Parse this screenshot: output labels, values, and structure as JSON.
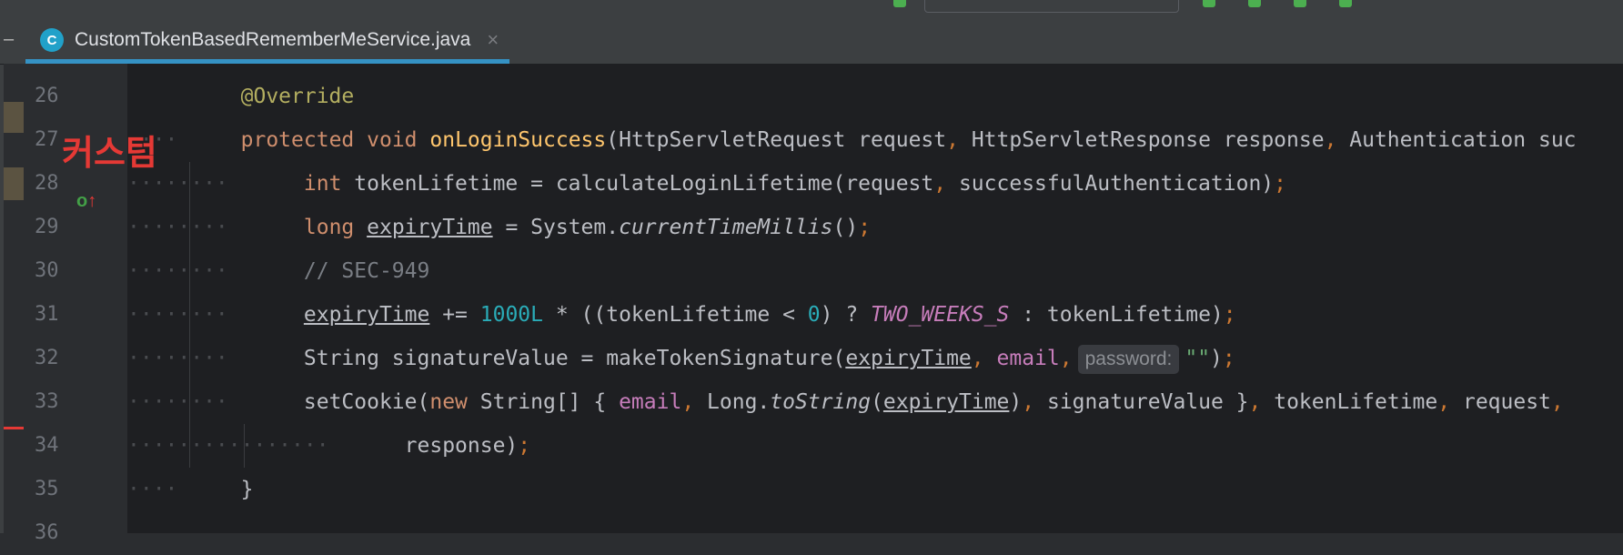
{
  "tab": {
    "icon_letter": "C",
    "filename": "CustomTokenBasedRememberMeService.java",
    "close_glyph": "×"
  },
  "overlay": {
    "korean_label": "커스텀"
  },
  "gutter": {
    "implements_icon": "override-implements-icon"
  },
  "lines": [
    {
      "num": "26"
    },
    {
      "num": "27"
    },
    {
      "num": "28"
    },
    {
      "num": "29"
    },
    {
      "num": "30"
    },
    {
      "num": "31"
    },
    {
      "num": "32"
    },
    {
      "num": "33"
    },
    {
      "num": "34"
    },
    {
      "num": "35"
    },
    {
      "num": "36"
    }
  ],
  "code": {
    "l26": {
      "annotation": "@Override"
    },
    "l27": {
      "kw1": "protected",
      "kw2": "void",
      "name": "onLoginSuccess",
      "rest": "(HttpServletRequest request",
      "c1": ",",
      "p2": " HttpServletResponse response",
      "c2": ",",
      "p3": " Authentication suc"
    },
    "l28": {
      "kw": "int",
      "a": " tokenLifetime = calculateLoginLifetime(request",
      "c": ",",
      "b": " successfulAuthentication)",
      "semi": ";"
    },
    "l29": {
      "kw": "long",
      "sp": " ",
      "var": "expiryTime",
      "a": " = System.",
      "method": "currentTimeMillis",
      "b": "()",
      "semi": ";"
    },
    "l30": {
      "comment": "// SEC-949"
    },
    "l31": {
      "var": "expiryTime",
      "a": " += ",
      "num1": "1000L",
      "b": " * ((tokenLifetime < ",
      "num2": "0",
      "c": ") ? ",
      "const": "TWO_WEEKS_S",
      "d": " : tokenLifetime)",
      "semi": ";"
    },
    "l32": {
      "a": "String signatureValue = makeTokenSignature(",
      "var": "expiryTime",
      "c1": ",",
      "sp": " ",
      "fld": "email",
      "c2": ",",
      "hint": "password:",
      "str": "\"\"",
      "b": ")",
      "semi": ";"
    },
    "l33": {
      "a": "setCookie(",
      "kw": "new",
      "b": " String[] { ",
      "fld": "email",
      "c1": ",",
      "c": " Long.",
      "method": "toString",
      "d": "(",
      "var": "expiryTime",
      "e": ")",
      "c2": ",",
      "f": " signatureValue }",
      "c3": ",",
      "g": " tokenLifetime",
      "c4": ",",
      "h": " request",
      "c5": ","
    },
    "l34": {
      "a": "response)",
      "semi": ";"
    },
    "l35": {
      "a": "}"
    }
  }
}
